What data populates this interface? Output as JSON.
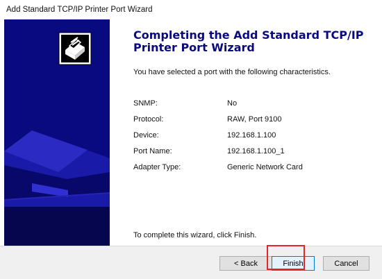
{
  "window": {
    "title": "Add Standard TCP/IP Printer Port Wizard"
  },
  "heading": "Completing the Add Standard TCP/IP Printer Port Wizard",
  "intro": "You have selected a port with the following characteristics.",
  "properties": [
    {
      "label": "SNMP:",
      "value": "No"
    },
    {
      "label": "Protocol:",
      "value": "RAW, Port 9100"
    },
    {
      "label": "Device:",
      "value": "192.168.1.100"
    },
    {
      "label": "Port Name:",
      "value": "192.168.1.100_1"
    },
    {
      "label": "Adapter Type:",
      "value": "Generic Network Card"
    }
  ],
  "footer_text": "To complete this wizard, click Finish.",
  "buttons": {
    "back": "< Back",
    "finish": "Finish",
    "cancel": "Cancel"
  },
  "colors": {
    "side_panel": "#0a0a80",
    "heading": "#0a0a80",
    "highlight": "#e0262b"
  },
  "icons": {
    "logo": "printer-wizard-icon",
    "art": "printer-illustration"
  }
}
